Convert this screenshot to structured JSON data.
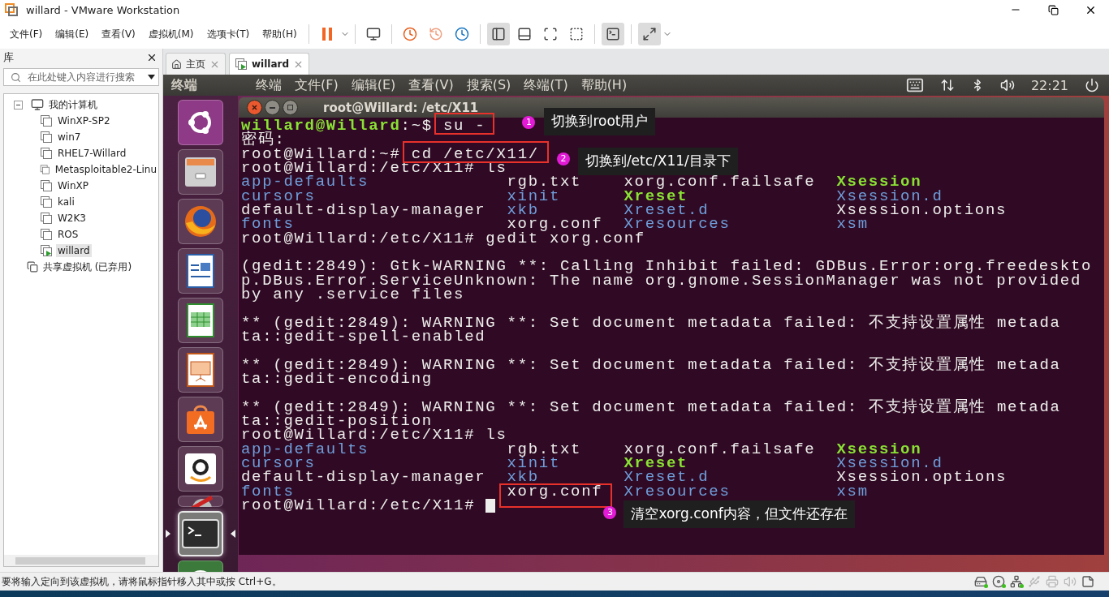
{
  "window": {
    "title": "willard - VMware Workstation"
  },
  "menu": [
    "文件(F)",
    "编辑(E)",
    "查看(V)",
    "虚拟机(M)",
    "选项卡(T)",
    "帮助(H)"
  ],
  "toolbar": [
    [
      {
        "kind": "pause",
        "selected": false
      }
    ],
    [
      {
        "kind": "send-keys",
        "selected": false
      }
    ],
    [
      {
        "kind": "snapshot-take",
        "selected": false
      },
      {
        "kind": "snapshot-revert",
        "selected": false
      },
      {
        "kind": "snapshot-manager",
        "selected": false
      }
    ],
    [
      {
        "kind": "library-view",
        "selected": true
      },
      {
        "kind": "thumbnail-bar",
        "selected": false
      },
      {
        "kind": "fullscreen",
        "selected": false
      },
      {
        "kind": "unity",
        "selected": false
      }
    ],
    [
      {
        "kind": "console",
        "selected": true
      }
    ],
    [
      {
        "kind": "stretch",
        "selected": true
      }
    ]
  ],
  "library": {
    "title": "库",
    "search": {
      "placeholder": "在此处键入内容进行搜索"
    },
    "tree": [
      {
        "label": "我的计算机",
        "kind": "computer",
        "expanded": true,
        "selected": false,
        "children": [
          {
            "label": "WinXP-SP2",
            "kind": "vm",
            "running": false,
            "selected": false
          },
          {
            "label": "win7",
            "kind": "vm",
            "running": false,
            "selected": false
          },
          {
            "label": "RHEL7-Willard",
            "kind": "vm",
            "running": false,
            "selected": false
          },
          {
            "label": "Metasploitable2-Linu",
            "kind": "vm",
            "running": false,
            "selected": false
          },
          {
            "label": "WinXP",
            "kind": "vm",
            "running": false,
            "selected": false
          },
          {
            "label": "kali",
            "kind": "vm",
            "running": false,
            "selected": false
          },
          {
            "label": "W2K3",
            "kind": "vm",
            "running": false,
            "selected": false
          },
          {
            "label": "ROS",
            "kind": "vm",
            "running": false,
            "selected": false
          },
          {
            "label": "willard",
            "kind": "vm",
            "running": true,
            "selected": true
          }
        ]
      },
      {
        "label": "共享虚拟机 (已弃用)",
        "kind": "shared",
        "selected": false
      }
    ]
  },
  "tabs": [
    {
      "label": "主页",
      "kind": "home",
      "selected": false
    },
    {
      "label": "willard",
      "kind": "vm",
      "selected": true
    }
  ],
  "guest": {
    "panel": {
      "app": "终端",
      "menus": [
        "终端",
        "文件(F)",
        "编辑(E)",
        "查看(V)",
        "搜索(S)",
        "终端(T)",
        "帮助(H)"
      ],
      "clock": "22:21"
    },
    "launcher": [
      {
        "kind": "ubuntu",
        "active": false
      },
      {
        "kind": "files",
        "active": false
      },
      {
        "kind": "browser",
        "active": false
      },
      {
        "kind": "writer",
        "active": false
      },
      {
        "kind": "calc",
        "active": false
      },
      {
        "kind": "impress",
        "active": false
      },
      {
        "kind": "software",
        "active": false
      },
      {
        "kind": "shop",
        "active": false
      },
      {
        "kind": "settings",
        "active": false
      },
      {
        "kind": "terminal",
        "active": true
      },
      {
        "kind": "updater",
        "active": false
      }
    ],
    "terminal": {
      "title": "root@Willard: /etc/X11",
      "lines": [
        {
          "kind": "text",
          "segments": [
            {
              "text": "willard@Willard",
              "kind": "user"
            },
            {
              "text": ":~$ ",
              "kind": "plain"
            },
            {
              "text": "su -",
              "kind": "plain",
              "note": {
                "number": "1",
                "text": "切换到root用户"
              }
            }
          ]
        },
        {
          "kind": "text",
          "segments": [
            {
              "text": "密码:",
              "kind": "plain"
            }
          ]
        },
        {
          "kind": "text",
          "segments": [
            {
              "text": "root@Willard:~# ",
              "kind": "plain"
            },
            {
              "text": "cd /etc/X11/",
              "kind": "plain",
              "note": {
                "number": "2",
                "text": "切换到/etc/X11/目录下"
              }
            }
          ]
        },
        {
          "kind": "text",
          "segments": [
            {
              "text": "root@Willard:/etc/X11# ls",
              "kind": "plain"
            }
          ]
        },
        {
          "kind": "ls",
          "files": [
            {
              "text": "app-defaults",
              "kind": "dir"
            },
            {
              "text": "rgb.txt",
              "kind": "file"
            },
            {
              "text": "xorg.conf.failsafe",
              "kind": "file"
            },
            {
              "text": "Xsession",
              "kind": "exec"
            }
          ]
        },
        {
          "kind": "ls",
          "files": [
            {
              "text": "cursors",
              "kind": "dir"
            },
            {
              "text": "xinit",
              "kind": "dir"
            },
            {
              "text": "Xreset",
              "kind": "exec"
            },
            {
              "text": "Xsession.d",
              "kind": "dir"
            }
          ]
        },
        {
          "kind": "ls",
          "files": [
            {
              "text": "default-display-manager",
              "kind": "file"
            },
            {
              "text": "xkb",
              "kind": "dir"
            },
            {
              "text": "Xreset.d",
              "kind": "dir"
            },
            {
              "text": "Xsession.options",
              "kind": "file"
            }
          ]
        },
        {
          "kind": "ls",
          "files": [
            {
              "text": "fonts",
              "kind": "dir"
            },
            {
              "text": "xorg.conf",
              "kind": "file"
            },
            {
              "text": "Xresources",
              "kind": "dir"
            },
            {
              "text": "xsm",
              "kind": "dir"
            }
          ]
        },
        {
          "kind": "text",
          "segments": [
            {
              "text": "root@Willard:/etc/X11# gedit xorg.conf",
              "kind": "plain"
            }
          ]
        },
        {
          "kind": "blank"
        },
        {
          "kind": "text",
          "segments": [
            {
              "text": "(gedit:2849): Gtk-WARNING **: Calling Inhibit failed: GDBus.Error:org.freedeskto",
              "kind": "plain"
            }
          ]
        },
        {
          "kind": "text",
          "segments": [
            {
              "text": "p.DBus.Error.ServiceUnknown: The name org.gnome.SessionManager was not provided",
              "kind": "plain"
            }
          ]
        },
        {
          "kind": "text",
          "segments": [
            {
              "text": "by any .service files",
              "kind": "plain"
            }
          ]
        },
        {
          "kind": "blank"
        },
        {
          "kind": "text",
          "segments": [
            {
              "text": "** (gedit:2849): WARNING **: Set document metadata failed: 不支持设置属性 metada",
              "kind": "plain"
            }
          ]
        },
        {
          "kind": "text",
          "segments": [
            {
              "text": "ta::gedit-spell-enabled",
              "kind": "plain"
            }
          ]
        },
        {
          "kind": "blank"
        },
        {
          "kind": "text",
          "segments": [
            {
              "text": "** (gedit:2849): WARNING **: Set document metadata failed: 不支持设置属性 metada",
              "kind": "plain"
            }
          ]
        },
        {
          "kind": "text",
          "segments": [
            {
              "text": "ta::gedit-encoding",
              "kind": "plain"
            }
          ]
        },
        {
          "kind": "blank"
        },
        {
          "kind": "text",
          "segments": [
            {
              "text": "** (gedit:2849): WARNING **: Set document metadata failed: 不支持设置属性 metada",
              "kind": "plain"
            }
          ]
        },
        {
          "kind": "text",
          "segments": [
            {
              "text": "ta::gedit-position",
              "kind": "plain"
            }
          ]
        },
        {
          "kind": "text",
          "segments": [
            {
              "text": "root@Willard:/etc/X11# ls",
              "kind": "plain"
            }
          ]
        },
        {
          "kind": "ls",
          "files": [
            {
              "text": "app-defaults",
              "kind": "dir"
            },
            {
              "text": "rgb.txt",
              "kind": "file"
            },
            {
              "text": "xorg.conf.failsafe",
              "kind": "file"
            },
            {
              "text": "Xsession",
              "kind": "exec"
            }
          ]
        },
        {
          "kind": "ls",
          "files": [
            {
              "text": "cursors",
              "kind": "dir"
            },
            {
              "text": "xinit",
              "kind": "dir"
            },
            {
              "text": "Xreset",
              "kind": "exec"
            },
            {
              "text": "Xsession.d",
              "kind": "dir"
            }
          ]
        },
        {
          "kind": "ls",
          "files": [
            {
              "text": "default-display-manager",
              "kind": "file"
            },
            {
              "text": "xkb",
              "kind": "dir"
            },
            {
              "text": "Xreset.d",
              "kind": "dir"
            },
            {
              "text": "Xsession.options",
              "kind": "file"
            }
          ]
        },
        {
          "kind": "ls",
          "files": [
            {
              "text": "fonts",
              "kind": "dir"
            },
            {
              "text": "xorg.conf",
              "kind": "file",
              "note": {
                "number": "3",
                "text": "清空xorg.conf内容，但文件还存在"
              }
            },
            {
              "text": "Xresources",
              "kind": "dir"
            },
            {
              "text": "xsm",
              "kind": "dir"
            }
          ]
        },
        {
          "kind": "text",
          "cursor": true,
          "segments": [
            {
              "text": "root@Willard:/etc/X11# ",
              "kind": "plain"
            }
          ]
        }
      ]
    }
  },
  "status_bar": {
    "message": "要将输入定向到该虚拟机，请将鼠标指针移入其中或按 Ctrl+G。",
    "devices": [
      {
        "kind": "disk",
        "connected": true
      },
      {
        "kind": "cd",
        "connected": true
      },
      {
        "kind": "network",
        "connected": true
      },
      {
        "kind": "usb",
        "connected": false
      },
      {
        "kind": "printer",
        "connected": false
      },
      {
        "kind": "sound",
        "connected": false
      },
      {
        "kind": "message",
        "connected": true
      }
    ]
  }
}
